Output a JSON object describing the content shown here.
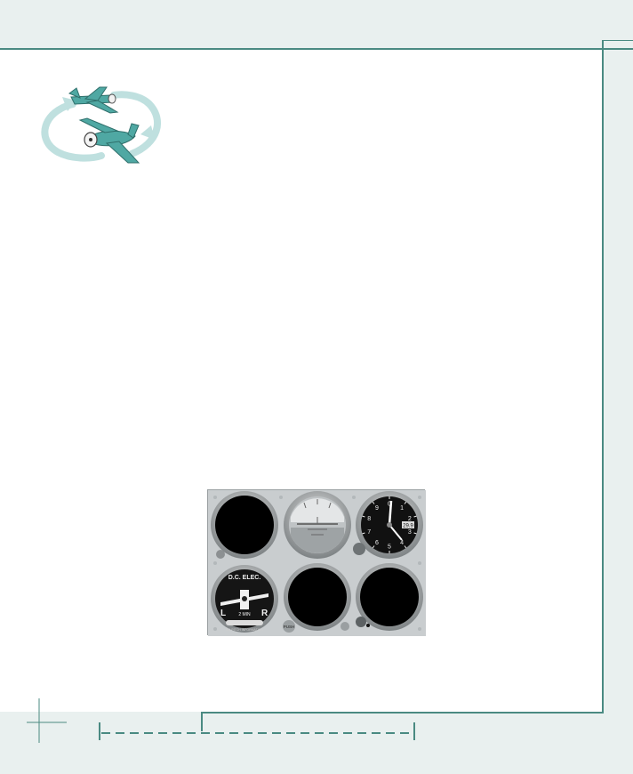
{
  "colors": {
    "background": "#e9f0ef",
    "page": "#ffffff",
    "frame": "#4a8a82",
    "plane": "#4fa8a3",
    "arrow": "#bfe0df"
  },
  "icons": {
    "header_icon": "two-airplanes-circling-icon"
  },
  "instrument_panel": {
    "turn_coordinator": {
      "label": "D.C. ELEC.",
      "left_mark": "L",
      "right_mark": "R",
      "sub_label": "2 MIN",
      "fine_print": "NO PITCH INFORMATION"
    },
    "altimeter": {
      "digits": [
        "0",
        "1",
        "2",
        "3",
        "4",
        "5",
        "6",
        "7",
        "8",
        "9"
      ],
      "window": "29.9"
    },
    "knob_label": "PUSH"
  }
}
